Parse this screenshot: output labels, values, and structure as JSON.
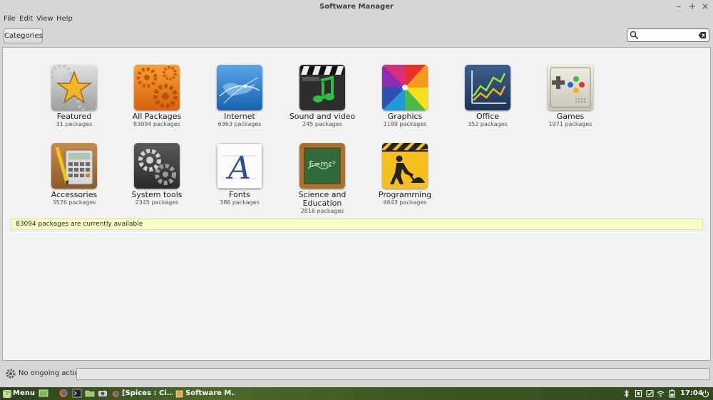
{
  "window": {
    "title": "Software Manager"
  },
  "menubar": {
    "items": [
      "File",
      "Edit",
      "View",
      "Help"
    ]
  },
  "toolbar": {
    "categories_label": "Categories",
    "search_value": ""
  },
  "categories": [
    {
      "name": "Featured",
      "count": "31 packages",
      "icon": "star-icon"
    },
    {
      "name": "All Packages",
      "count": "83094 packages",
      "icon": "gears-icon"
    },
    {
      "name": "Internet",
      "count": "6363 packages",
      "icon": "globe-icon"
    },
    {
      "name": "Sound and video",
      "count": "245 packages",
      "icon": "music-clapper-icon"
    },
    {
      "name": "Graphics",
      "count": "1189 packages",
      "icon": "color-wheel-icon"
    },
    {
      "name": "Office",
      "count": "352 packages",
      "icon": "chart-icon"
    },
    {
      "name": "Games",
      "count": "1971 packages",
      "icon": "gamepad-icon"
    },
    {
      "name": "Accessories",
      "count": "3576 packages",
      "icon": "calculator-icon"
    },
    {
      "name": "System tools",
      "count": "2345 packages",
      "icon": "system-gears-icon"
    },
    {
      "name": "Fonts",
      "count": "386 packages",
      "icon": "font-icon"
    },
    {
      "name": "Science and Education",
      "count": "2816 packages",
      "icon": "chalkboard-icon"
    },
    {
      "name": "Programming",
      "count": "6643 packages",
      "icon": "construction-icon"
    }
  ],
  "info": {
    "text": "83094 packages are currently available"
  },
  "status": {
    "text": "No ongoing actions"
  },
  "taskbar": {
    "menu_label": "Menu",
    "windows": [
      "[Spices : Ci...",
      "Software M..."
    ],
    "clock": "17:04"
  },
  "colors": {
    "accent_green": "#6fa531",
    "info_background": "#fbfbc6"
  }
}
